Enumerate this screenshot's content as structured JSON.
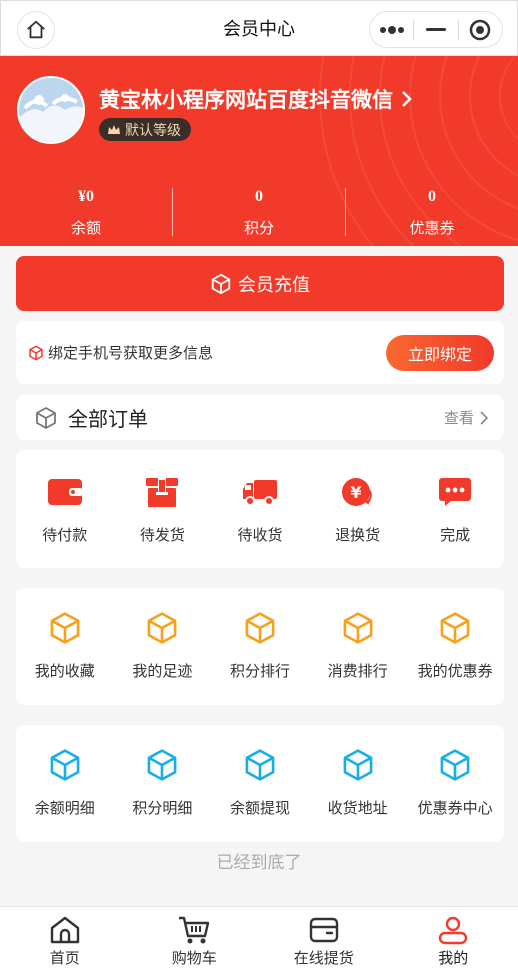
{
  "nav": {
    "title": "会员中心"
  },
  "colors": {
    "brand": "#f23a2b",
    "orange_icon": "#f5a11c",
    "blue_icon": "#1aaee8"
  },
  "profile": {
    "name": "黄宝林小程序网站百度抖音微信",
    "level": "默认等级"
  },
  "stats": [
    {
      "value": "¥0",
      "label": "余额"
    },
    {
      "value": "0",
      "label": "积分"
    },
    {
      "value": "0",
      "label": "优惠券"
    }
  ],
  "recharge": {
    "label": "会员充值"
  },
  "bind": {
    "text": "绑定手机号获取更多信息",
    "button": "立即绑定"
  },
  "orders": {
    "title": "全部订单",
    "view": "查看",
    "items": [
      {
        "label": "待付款",
        "icon": "wallet-icon"
      },
      {
        "label": "待发货",
        "icon": "box-icon"
      },
      {
        "label": "待收货",
        "icon": "truck-icon"
      },
      {
        "label": "退换货",
        "icon": "refund-icon"
      },
      {
        "label": "完成",
        "icon": "chat-icon"
      }
    ]
  },
  "services": {
    "items": [
      {
        "label": "我的收藏",
        "icon": "cube-icon"
      },
      {
        "label": "我的足迹",
        "icon": "cube-icon"
      },
      {
        "label": "积分排行",
        "icon": "cube-icon"
      },
      {
        "label": "消费排行",
        "icon": "cube-icon"
      },
      {
        "label": "我的优惠券",
        "icon": "cube-icon"
      }
    ]
  },
  "finance": {
    "items": [
      {
        "label": "余额明细",
        "icon": "cube-icon"
      },
      {
        "label": "积分明细",
        "icon": "cube-icon"
      },
      {
        "label": "余额提现",
        "icon": "cube-icon"
      },
      {
        "label": "收货地址",
        "icon": "cube-icon"
      },
      {
        "label": "优惠券中心",
        "icon": "cube-icon"
      }
    ]
  },
  "footer_tip": "已经到底了",
  "tabbar": [
    {
      "label": "首页",
      "icon": "home-icon"
    },
    {
      "label": "购物车",
      "icon": "cart-icon"
    },
    {
      "label": "在线提货",
      "icon": "wallet-icon"
    },
    {
      "label": "我的",
      "icon": "user-icon"
    }
  ]
}
